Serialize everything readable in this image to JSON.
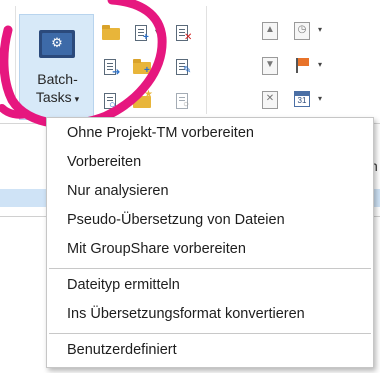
{
  "ribbon": {
    "batch_tasks": {
      "label_line1": "Batch-",
      "label_line2": "Tasks",
      "caret": "▾",
      "icon": "batch-tasks-gear-icon"
    },
    "calendar_day": "31",
    "peek_char": "n"
  },
  "menu": {
    "items": [
      {
        "label": "Ohne Projekt-TM vorbereiten"
      },
      {
        "label": "Vorbereiten"
      },
      {
        "label": "Nur analysieren"
      },
      {
        "label": "Pseudo-Übersetzung von Dateien"
      },
      {
        "label": "Mit GroupShare vorbereiten"
      },
      {
        "label": "Dateityp ermitteln"
      },
      {
        "label": "Ins Übersetzungsformat konvertieren"
      },
      {
        "label": "Benutzerdefiniert"
      }
    ]
  },
  "colors": {
    "selected_button_bg": "#d7e9f8",
    "annotation": "#e6177f",
    "list_selection": "#cfe3f6"
  }
}
